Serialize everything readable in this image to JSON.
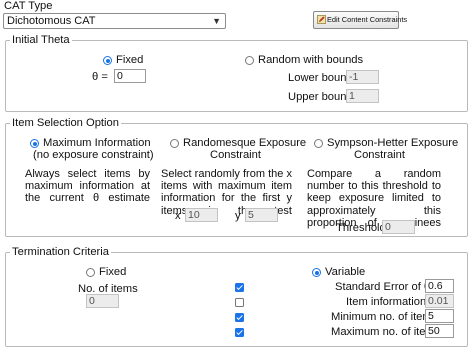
{
  "cat_type": {
    "label": "CAT Type",
    "selected": "Dichotomous CAT",
    "edit_button": "Edit Content Constraints"
  },
  "initial_theta": {
    "legend": "Initial Theta",
    "fixed_label": "Fixed",
    "fixed_selected": true,
    "theta_label": "θ =",
    "theta_value": "0",
    "random_label": "Random with bounds",
    "lower_label": "Lower bound",
    "lower_value": "-1",
    "upper_label": "Upper bound",
    "upper_value": "1"
  },
  "item_selection": {
    "legend": "Item Selection Option",
    "max_info_line1": "Maximum Information",
    "max_info_line2": "(no exposure constraint)",
    "max_info_selected": true,
    "max_info_desc": "Always select items by maximum information at the current θ estimate",
    "randomesque_line1": "Randomesque Exposure",
    "randomesque_line2": "Constraint",
    "randomesque_desc": "Select randomly from the x items with maximum item information for the first y items in the test",
    "x_label": "x",
    "x_value": "10",
    "y_label": "y",
    "y_value": "5",
    "sympson_line1": "Sympson-Hetter Exposure",
    "sympson_line2": "Constraint",
    "sympson_desc": "Compare a random number to this threshold to keep exposure limited to approximately this proportion of examinees",
    "threshold_label": "Threshold",
    "threshold_value": "0"
  },
  "termination": {
    "legend": "Termination Criteria",
    "fixed_label": "Fixed",
    "no_items_label": "No. of items",
    "no_items_value": "0",
    "variable_label": "Variable",
    "variable_selected": true,
    "se_label": "Standard Error of θ ≤",
    "se_checked": true,
    "se_value": "0.6",
    "info_label": "Item information ≤",
    "info_checked": false,
    "info_value": "0.01",
    "min_label": "Minimum no. of items",
    "min_checked": true,
    "min_value": "5",
    "max_label": "Maximum no. of items",
    "max_checked": true,
    "max_value": "50"
  },
  "colors": {
    "accent": "#1a73e8",
    "border": "#b9b9b9",
    "disabled_field": "#ececec"
  }
}
